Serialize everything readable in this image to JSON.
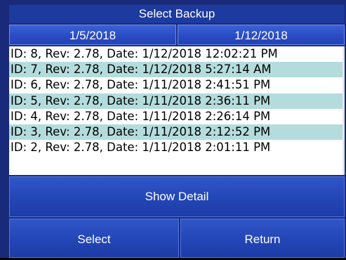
{
  "header": {
    "title": "Select Backup"
  },
  "date_tabs": [
    {
      "label": "1/5/2018"
    },
    {
      "label": "1/12/2018"
    }
  ],
  "backups": [
    {
      "text": "ID: 8, Rev: 2.78, Date: 1/12/2018 12:02:21 PM"
    },
    {
      "text": "ID: 7, Rev: 2.78, Date: 1/12/2018 5:27:14 AM"
    },
    {
      "text": "ID: 6, Rev: 2.78, Date: 1/11/2018 2:41:51 PM"
    },
    {
      "text": "ID: 5, Rev: 2.78, Date: 1/11/2018 2:36:11 PM"
    },
    {
      "text": "ID: 4, Rev: 2.78, Date: 1/11/2018 2:26:14 PM"
    },
    {
      "text": "ID: 3, Rev: 2.78, Date: 1/11/2018 2:12:52 PM"
    },
    {
      "text": "ID: 2, Rev: 2.78, Date: 1/11/2018 2:01:11 PM"
    }
  ],
  "buttons": {
    "show_detail": "Show Detail",
    "select": "Select",
    "return": "Return"
  },
  "colors": {
    "title_bar": "#1d3a9e",
    "button_blue": "#2447b8",
    "row_alt": "#b4dcdc"
  }
}
